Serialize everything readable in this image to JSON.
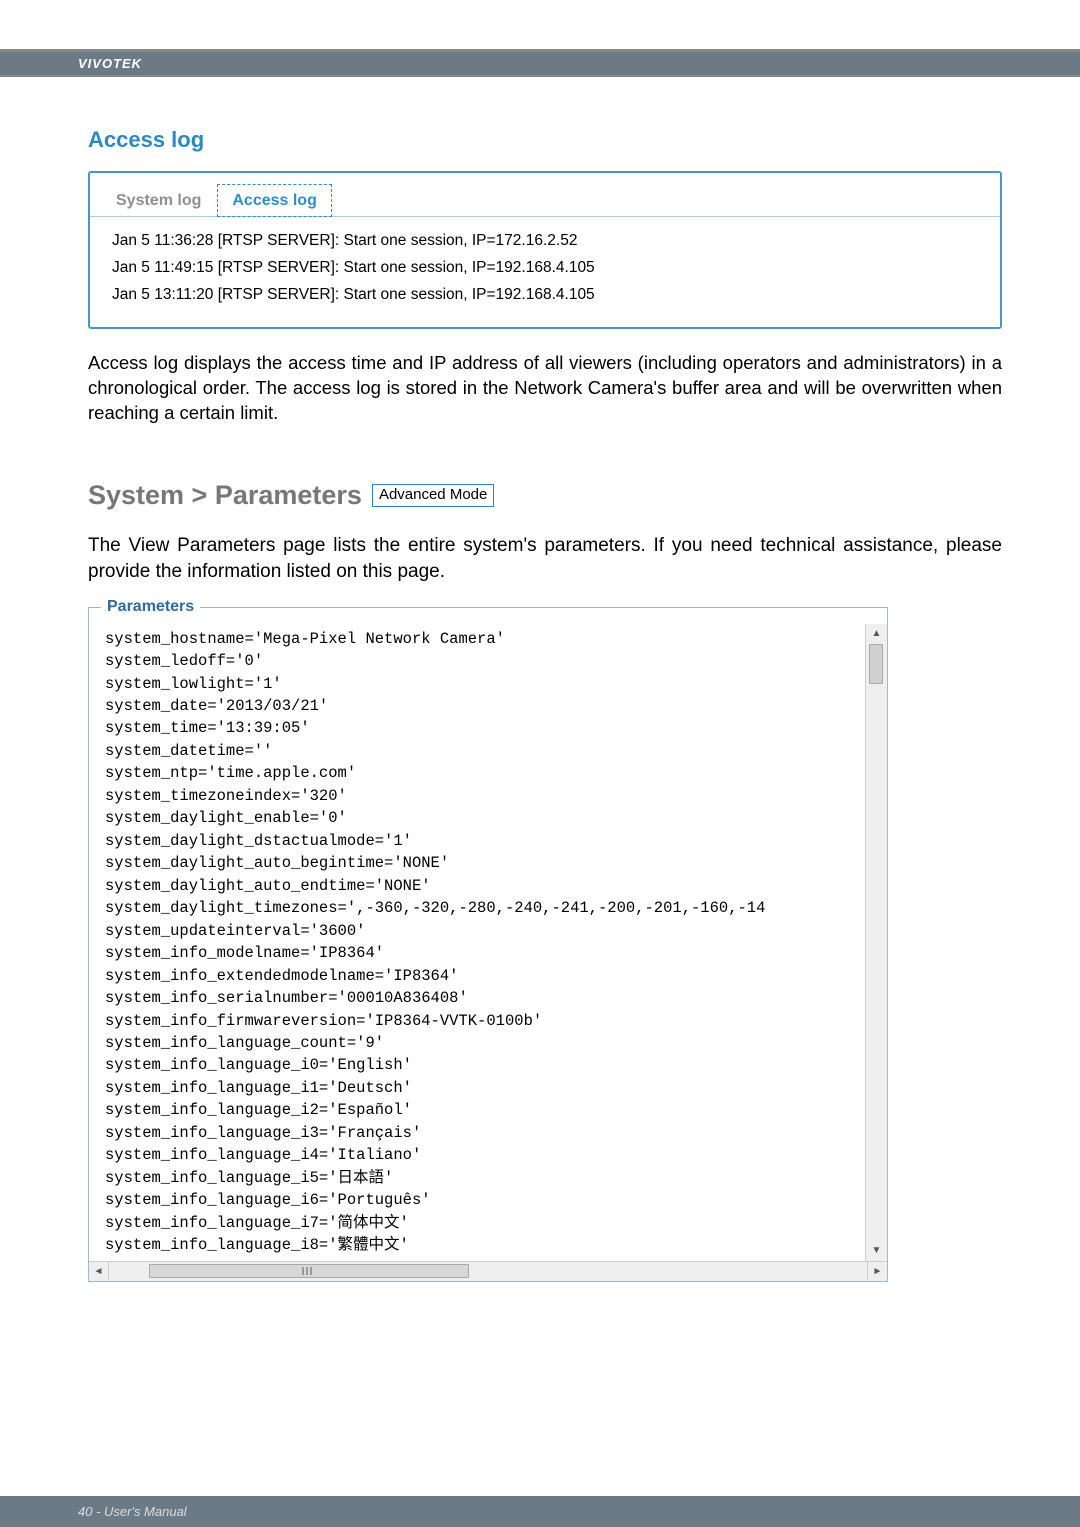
{
  "brand": "VIVOTEK",
  "sections": {
    "access_log": {
      "title": "Access log",
      "tabs": {
        "system": "System log",
        "access": "Access log"
      },
      "entries": [
        "Jan 5 11:36:28 [RTSP SERVER]: Start one session, IP=172.16.2.52",
        "Jan 5 11:49:15 [RTSP SERVER]: Start one session, IP=192.168.4.105",
        "Jan 5 13:11:20 [RTSP SERVER]: Start one session, IP=192.168.4.105"
      ],
      "description": "Access log displays the access time and IP address of all viewers (including operators and administrators) in a chronological order. The access log is stored in the Network Camera's buffer area and will be overwritten when reaching a certain limit."
    },
    "parameters": {
      "heading": "System > Parameters",
      "badge": "Advanced Mode",
      "description": "The View Parameters page lists the entire system's parameters. If you need technical assistance, please provide the information listed on this page.",
      "legend": "Parameters",
      "lines": [
        "system_hostname='Mega-Pixel Network Camera'",
        "system_ledoff='0'",
        "system_lowlight='1'",
        "system_date='2013/03/21'",
        "system_time='13:39:05'",
        "system_datetime=''",
        "system_ntp='time.apple.com'",
        "system_timezoneindex='320'",
        "system_daylight_enable='0'",
        "system_daylight_dstactualmode='1'",
        "system_daylight_auto_begintime='NONE'",
        "system_daylight_auto_endtime='NONE'",
        "system_daylight_timezones=',-360,-320,-280,-240,-241,-200,-201,-160,-14",
        "system_updateinterval='3600'",
        "system_info_modelname='IP8364'",
        "system_info_extendedmodelname='IP8364'",
        "system_info_serialnumber='00010A836408'",
        "system_info_firmwareversion='IP8364-VVTK-0100b'",
        "system_info_language_count='9'",
        "system_info_language_i0='English'",
        "system_info_language_i1='Deutsch'",
        "system_info_language_i2='Español'",
        "system_info_language_i3='Français'",
        "system_info_language_i4='Italiano'",
        "system_info_language_i5='日本語'",
        "system_info_language_i6='Português'",
        "system_info_language_i7='简体中文'",
        "system_info_language_i8='繁體中文'"
      ]
    }
  },
  "footer": "40 - User's Manual"
}
